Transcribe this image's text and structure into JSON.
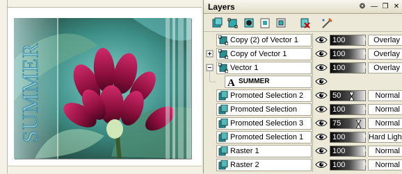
{
  "canvas": {
    "vertical_text": "SUMMER"
  },
  "panel": {
    "title": "Layers",
    "titlebar_buttons": [
      {
        "name": "pin-button",
        "glyph": "❂"
      },
      {
        "name": "minimize-button",
        "glyph": "—"
      },
      {
        "name": "restore-button",
        "glyph": "❐"
      },
      {
        "name": "close-button",
        "glyph": "✕"
      }
    ],
    "toolbar_icons": [
      "new-raster-layer-icon",
      "new-vector-layer-icon",
      "new-mask-layer-icon",
      "duplicate-layer-icon",
      "new-adjustment-layer-icon",
      "delete-layer-icon",
      "edit-selection-icon"
    ]
  },
  "layers": [
    {
      "name": "Copy (2) of Vector 1",
      "type": "vector",
      "opacity": "100",
      "blend": "Overlay",
      "expander": "none",
      "indent": 0,
      "selected": false
    },
    {
      "name": "Copy of Vector 1",
      "type": "vector",
      "opacity": "100",
      "blend": "Overlay",
      "expander": "plus",
      "indent": 0,
      "selected": false
    },
    {
      "name": "Vector 1",
      "type": "vector",
      "opacity": "100",
      "blend": "Overlay",
      "expander": "minus",
      "indent": 0,
      "selected": false
    },
    {
      "name": "SUMMER",
      "type": "text",
      "opacity": "",
      "blend": "",
      "expander": "child",
      "indent": 1,
      "selected": false
    },
    {
      "name": "Promoted Selection 2",
      "type": "raster",
      "opacity": "50",
      "opacity_fraction": 0.5,
      "blend": "Normal",
      "expander": "none",
      "indent": 0,
      "selected": false
    },
    {
      "name": "Promoted Selection",
      "type": "raster",
      "opacity": "100",
      "blend": "Normal",
      "expander": "none",
      "indent": 0,
      "selected": false
    },
    {
      "name": "Promoted Selection 3",
      "type": "raster",
      "opacity": "75",
      "opacity_fraction": 0.75,
      "blend": "Normal",
      "expander": "none",
      "indent": 0,
      "selected": false
    },
    {
      "name": "Promoted Selection 1",
      "type": "raster",
      "opacity": "100",
      "blend": "Hard Light",
      "expander": "none",
      "indent": 0,
      "selected": false
    },
    {
      "name": "Raster 1",
      "type": "raster",
      "opacity": "100",
      "blend": "Normal",
      "expander": "none",
      "indent": 0,
      "selected": false
    },
    {
      "name": "Raster 2",
      "type": "raster",
      "opacity": "100",
      "blend": "Normal",
      "expander": "none",
      "indent": 0,
      "selected": false
    }
  ],
  "colors": {
    "panel_bg": "#ece9d8",
    "layer_thumb": "#2a8f8f",
    "flower": "#8c0f3c"
  }
}
